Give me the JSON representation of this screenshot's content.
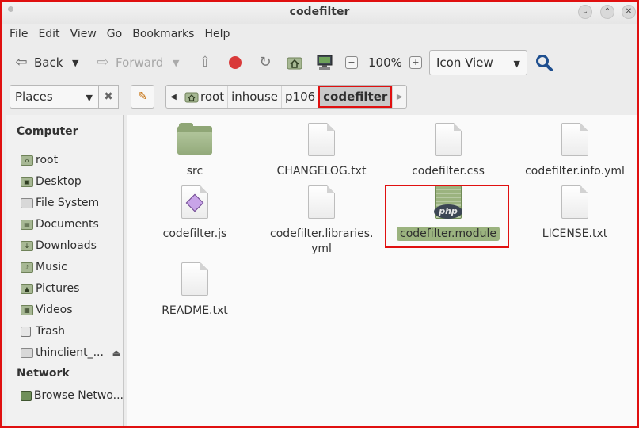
{
  "window": {
    "title": "codefilter"
  },
  "menu": [
    "File",
    "Edit",
    "View",
    "Go",
    "Bookmarks",
    "Help"
  ],
  "toolbar": {
    "back": "Back",
    "forward": "Forward",
    "zoom": "100%",
    "view_mode": "Icon View"
  },
  "location": {
    "places": "Places",
    "crumbs": [
      "root",
      "inhouse",
      "p106",
      "codefilter"
    ]
  },
  "sidebar": {
    "computer_heading": "Computer",
    "computer_items": [
      "root",
      "Desktop",
      "File System",
      "Documents",
      "Downloads",
      "Music",
      "Pictures",
      "Videos",
      "Trash",
      "thinclient_..."
    ],
    "network_heading": "Network",
    "network_items": [
      "Browse Netwo..."
    ]
  },
  "files": [
    {
      "name": "src",
      "type": "folder"
    },
    {
      "name": "CHANGELOG.txt",
      "type": "text"
    },
    {
      "name": "codefilter.css",
      "type": "text"
    },
    {
      "name": "codefilter.info.yml",
      "type": "text"
    },
    {
      "name": "codefilter.js",
      "type": "js"
    },
    {
      "name": "codefilter.libraries.",
      "name2": "yml",
      "type": "text"
    },
    {
      "name": "codefilter.module",
      "type": "php",
      "selected": true
    },
    {
      "name": "LICENSE.txt",
      "type": "text"
    },
    {
      "name": "README.txt",
      "type": "text"
    }
  ],
  "icons": {
    "php_label": "php"
  },
  "colors": {
    "selection": "#9bb37f",
    "annotation": "#e01010",
    "folder": "#8fa676"
  }
}
